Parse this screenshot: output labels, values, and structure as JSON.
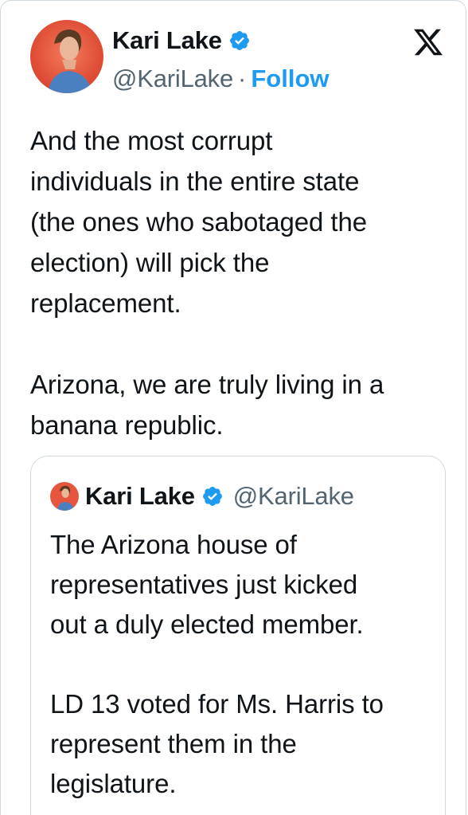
{
  "tweet": {
    "author": {
      "display_name": "Kari Lake",
      "handle": "@KariLake",
      "verified": true,
      "avatar_icon": "profile-photo"
    },
    "separator": "·",
    "follow_label": "Follow",
    "platform_icon": "x-logo-icon",
    "text": "And the most corrupt\nindividuals in the entire state\n(the ones who sabotaged the\nelection) will pick the\nreplacement.\n\nArizona, we are truly living in a\nbanana republic.",
    "quoted_tweet": {
      "author": {
        "display_name": "Kari Lake",
        "handle": "@KariLake",
        "verified": true
      },
      "text": "The Arizona house of\nrepresentatives just kicked\nout a duly elected member.\n\nLD 13 voted for Ms. Harris to\nrepresent them in the\nlegislature."
    }
  },
  "colors": {
    "text": "#0f1419",
    "secondary_text": "#536471",
    "accent": "#1d9bf0",
    "border": "#cfd9de",
    "avatar_background": "#e8553f"
  }
}
